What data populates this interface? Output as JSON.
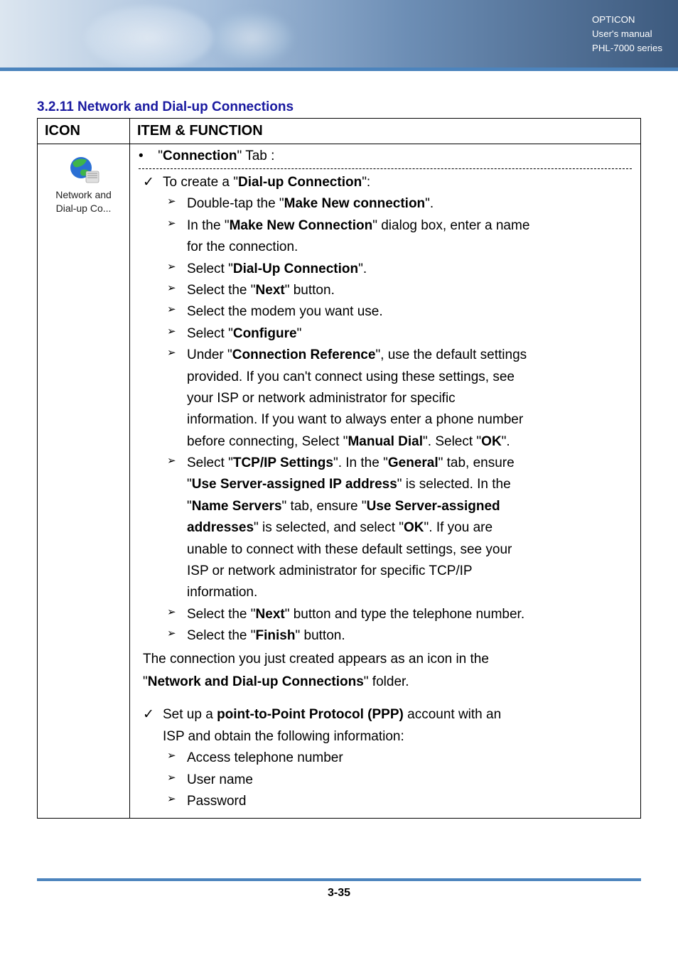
{
  "header": {
    "brand": "OPTICON",
    "line2": "User's manual",
    "line3": "PHL-7000 series"
  },
  "section_title": "3.2.11 Network and Dial-up Connections",
  "table": {
    "col1": "ICON",
    "col2": "ITEM & FUNCTION"
  },
  "icon_labels": {
    "l1": "Network and",
    "l2": "Dial-up Co..."
  },
  "tab": {
    "pre": "\"",
    "label": "Connection",
    "post": "\" Tab :"
  },
  "lines": {
    "c1_a": "To create a \"",
    "c1_b": "Dial-up Connection",
    "c1_c": "\":",
    "d1_a": "Double-tap the \"",
    "d1_b": "Make New connection",
    "d1_c": "\".",
    "d2_a": "In the \"",
    "d2_b": "Make New Connection",
    "d2_c": "\" dialog box, enter a name",
    "d2_cont": "for the connection.",
    "d3_a": "Select \"",
    "d3_b": "Dial-Up Connection",
    "d3_c": "\".",
    "d4_a": "Select the \"",
    "d4_b": "Next",
    "d4_c": "\" button.",
    "d5": "Select the modem you want use.",
    "d6_a": "Select \"",
    "d6_b": "Configure",
    "d6_c": "\"",
    "d7_a": "Under \"",
    "d7_b": "Connection Reference",
    "d7_c": "\", use the default settings",
    "d7_l2": "provided. If you can't connect using these settings, see",
    "d7_l3": "your ISP or network administrator for specific",
    "d7_l4": "information. If you want to always enter a phone number",
    "d7_l5a": "before connecting, Select \"",
    "d7_l5b": "Manual Dial",
    "d7_l5c": "\". Select \"",
    "d7_l5d": "OK",
    "d7_l5e": "\".",
    "d8_a": "Select \"",
    "d8_b": "TCP/IP Settings",
    "d8_c": "\". In the \"",
    "d8_d": "General",
    "d8_e": "\" tab, ensure",
    "d8_l2a": "\"",
    "d8_l2b": "Use Server-assigned IP address",
    "d8_l2c": "\" is selected. In the",
    "d8_l3a": "\"",
    "d8_l3b": "Name Servers",
    "d8_l3c": "\" tab, ensure \"",
    "d8_l3d": "Use Server-assigned",
    "d8_l4a": "addresses",
    "d8_l4b": "\" is selected, and select \"",
    "d8_l4c": "OK",
    "d8_l4d": "\". If you are",
    "d8_l5": "unable to connect with these default settings, see your",
    "d8_l6": "ISP or network administrator for specific TCP/IP",
    "d8_l7": "information.",
    "d9_a": "Select the \"",
    "d9_b": "Next",
    "d9_c": "\" button and type the telephone number.",
    "d10_a": "Select the \"",
    "d10_b": "Finish",
    "d10_c": "\" button.",
    "p1": "The connection you just created appears as an icon in the",
    "p2a": "\"",
    "p2b": "Network and Dial-up Connections",
    "p2c": "\" folder.",
    "c2_a": "Set up a ",
    "c2_b": "point-to-Point Protocol (PPP)",
    "c2_c": " account with an",
    "c2_l2": "ISP and obtain the following information:",
    "e1": "Access telephone number",
    "e2": "User name",
    "e3": "Password"
  },
  "footer": "3-35"
}
